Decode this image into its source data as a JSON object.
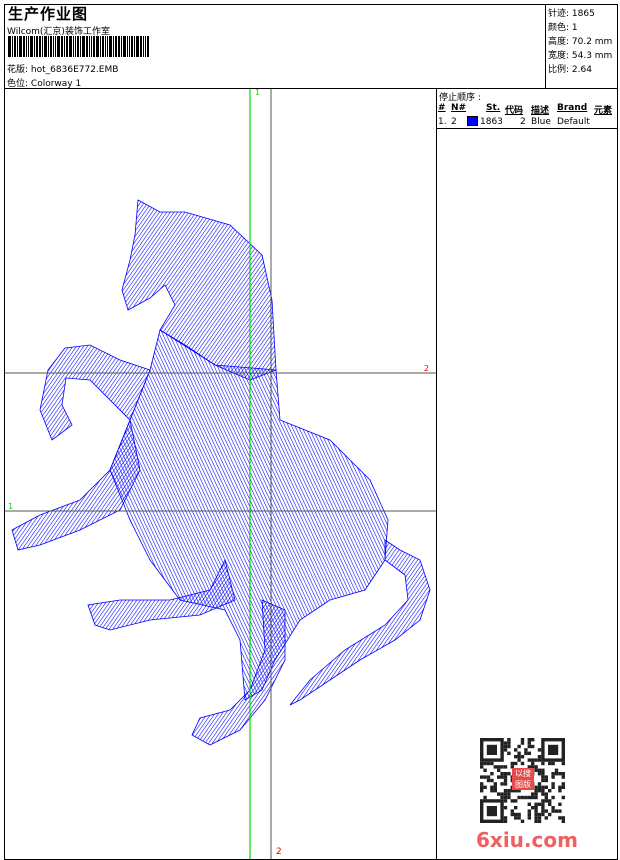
{
  "header": {
    "title": "生产作业图",
    "company": "Wilcom(汇京)装饰工作室",
    "design_label": "花版:",
    "design_value": "hot_6836E772.EMB",
    "colorway_label": "色位:",
    "colorway_value": "Colorway 1"
  },
  "stats": {
    "stitches": "针迹: 1865",
    "colors": "颜色: 1",
    "height": "高度: 70.2 mm",
    "width": "宽度: 54.3 mm",
    "ratio": "比例: 2.64"
  },
  "stop_sequence": {
    "title": "停止顺序 :",
    "columns": [
      "#",
      "N#",
      "St.",
      "代码",
      "描述",
      "Brand",
      "元素"
    ],
    "rows": [
      {
        "index": "1.",
        "needle": "2",
        "color": "#0000ff",
        "stitches": "1863",
        "code": "2",
        "description": "Blue",
        "brand": "Default",
        "element": ""
      }
    ]
  },
  "guides": {
    "top_marker": "1",
    "right_marker": "2",
    "left_marker": "1",
    "bottom_marker": "2"
  },
  "colors": {
    "thread": "#0000ff",
    "guide_green": "#00dd00",
    "marker_red": "#dd0000"
  },
  "watermark": {
    "text": "6xiu.com",
    "stamp": "以图搜版"
  }
}
